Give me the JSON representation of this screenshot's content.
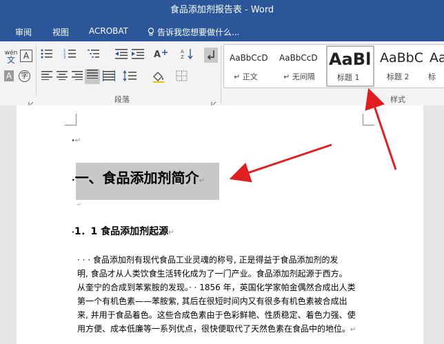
{
  "window": {
    "title": "食品添加剂报告表 - Word"
  },
  "menu": {
    "items": [
      "审阅",
      "视图",
      "ACROBAT"
    ],
    "tell_me": "告诉我您想要做什么..."
  },
  "ribbon": {
    "paragraph_label": "段落",
    "styles_label": "样式",
    "wen_top": "wén",
    "wen_bottom": "文",
    "a_box": "A",
    "zi": "字",
    "a_gray": "A",
    "styles": [
      {
        "preview": "AaBbCcD",
        "name": "↵ 正文"
      },
      {
        "preview": "AaBbCcD",
        "name": "↵ 无间隔"
      },
      {
        "preview": "AaBl",
        "name": "标题 1"
      },
      {
        "preview": "AaBbC",
        "name": "标题 2"
      },
      {
        "preview": "Aa",
        "name": "标"
      }
    ]
  },
  "document": {
    "heading1": "一、食品添加剂简介",
    "heading2": "1．1 食品添加剂起源",
    "body_lines": [
      "· · · 食品添加剂有现代食品工业灵魂的称号, 正是得益于食品添加剂的发",
      "明, 食品才从人类饮食生活转化成为了一门产业。食品添加剂起源于西方。",
      "从奎宁的合成到苯紫胺的发现。· · 1856 年，英国化学家帕金偶然合成出人类",
      "第一个有机色素——苯胺紫, 其后在很短时间内又有很多有机色素被合成出",
      "来, 并用于食品着色。这些合成色素由于色彩鲜艳、性质稳定、着色力强、使",
      "用方便、成本低廉等一系列优点，很快便取代了天然色素在食品中的地位。"
    ],
    "para_mark": "↵"
  },
  "colors": {
    "brand": "#2b579a",
    "arrow": "#e02020",
    "highlight": "#c8c8c8"
  }
}
